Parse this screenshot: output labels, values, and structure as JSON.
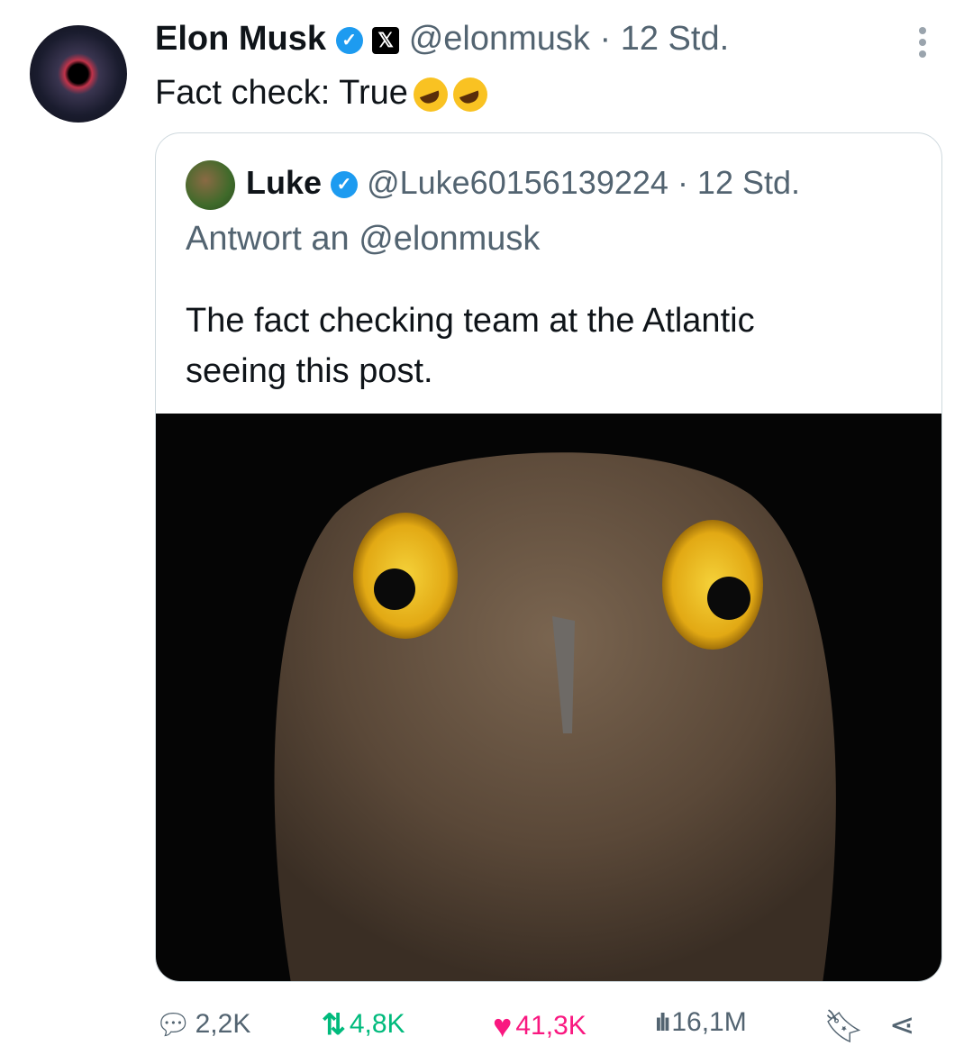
{
  "tweet": {
    "author": "Elon Musk",
    "handle": "@elonmusk",
    "time": "· 12 Std.",
    "text": "Fact check: True",
    "x_badge": "𝕏"
  },
  "quote": {
    "author": "Luke",
    "handle": "@Luke60156139224",
    "time": "· 12 Std.",
    "reply_to": "Antwort an @elonmusk",
    "text": "The fact checking team at the Atlantic seeing this post."
  },
  "actions": {
    "replies": "2,2K",
    "reposts": "4,8K",
    "likes": "41,3K",
    "views": "16,1M"
  },
  "colors": {
    "repost": "#00ba7c",
    "like": "#f91880",
    "verified": "#1d9bf0"
  }
}
